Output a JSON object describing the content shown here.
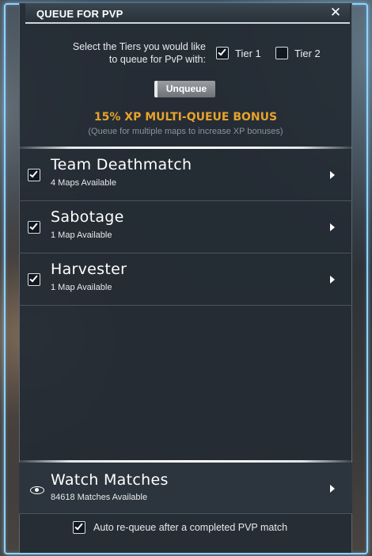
{
  "window": {
    "title": "QUEUE FOR PVP",
    "close_label": "✕"
  },
  "tiers": {
    "prompt_line1": "Select the Tiers you would like",
    "prompt_line2": "to queue for PvP with:",
    "options": [
      {
        "label": "Tier 1",
        "checked": true
      },
      {
        "label": "Tier 2",
        "checked": false
      }
    ]
  },
  "unqueue_label": "Unqueue",
  "bonus": {
    "title": "15% XP MULTI-QUEUE BONUS",
    "subtitle": "(Queue for multiple maps to increase XP bonuses)"
  },
  "maps": [
    {
      "name": "Team Deathmatch",
      "sub": "4 Maps Available",
      "checked": true
    },
    {
      "name": "Sabotage",
      "sub": "1 Map Available",
      "checked": true
    },
    {
      "name": "Harvester",
      "sub": "1 Map Available",
      "checked": true
    }
  ],
  "watch": {
    "title": "Watch Matches",
    "sub": "84618 Matches Available"
  },
  "auto_requeue": {
    "label": "Auto re-queue after a completed PVP match",
    "checked": true
  },
  "colors": {
    "accent_frame": "#8fd3ff",
    "bonus": "#e8a32a"
  }
}
